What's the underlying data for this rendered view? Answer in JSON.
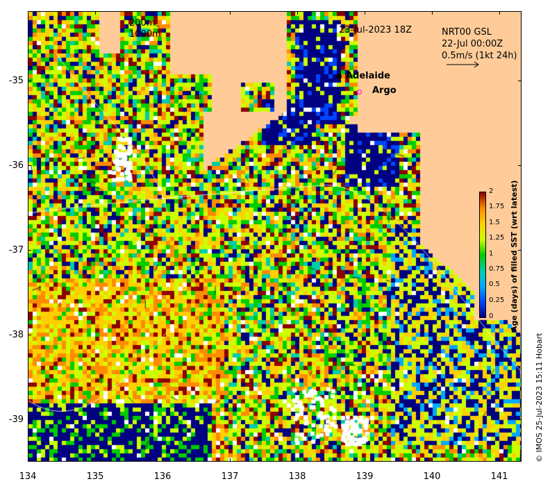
{
  "map": {
    "date_label": "23-Jul-2023 18Z",
    "product_label": "NRT00 GSL",
    "current_time_label": "22-Jul 00:00Z",
    "vector_scale_label": "0.5m/s (1kt 24h)",
    "bathymetry_labels": [
      "200m",
      "1000m"
    ],
    "places": [
      {
        "name": "Adelaide",
        "marker": "filled-circle",
        "color": "#000000"
      },
      {
        "name": "Argo",
        "marker": "open-circle",
        "color": "#ff00ff"
      }
    ],
    "y_ticks": [
      "-35",
      "-36",
      "-37",
      "-38",
      "-39"
    ],
    "x_ticks": [
      "134",
      "135",
      "136",
      "137",
      "138",
      "139",
      "140",
      "141"
    ],
    "land_color": "#ffcc99",
    "colorbar": {
      "title": "Age (days) of filled SST (wrt latest)",
      "ticks": [
        "2",
        "1.75",
        "1.5",
        "1.25",
        "1",
        "0.75",
        "0.5",
        "0.25",
        "0"
      ],
      "colors": [
        "#8b0000",
        "#ff8c00",
        "#ffd000",
        "#ccff00",
        "#00cc00",
        "#00ccaa",
        "#00aaff",
        "#0044ff",
        "#000080"
      ]
    },
    "credit": "© IMOS 25-Jul-2023 15:11 Hobart"
  }
}
